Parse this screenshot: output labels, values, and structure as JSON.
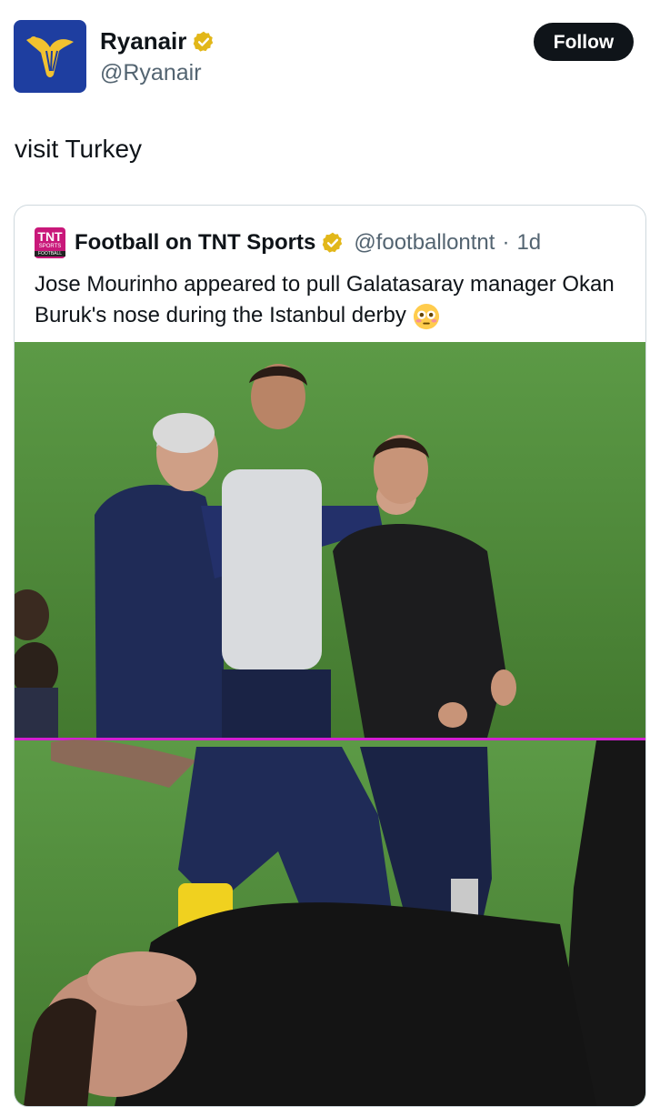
{
  "author": {
    "name": "Ryanair",
    "handle": "@Ryanair",
    "follow_label": "Follow"
  },
  "tweet": {
    "text": "visit Turkey"
  },
  "quoted_tweet": {
    "logo_text": "TNT",
    "logo_subtext": "SPORTS",
    "logo_footer": "FOOTBALL",
    "name": "Football on TNT Sports",
    "handle": "@footballontnt",
    "separator": "·",
    "time": "1d",
    "text": "Jose Mourinho appeared to pull Galatasaray manager Okan Buruk's nose during the Istanbul derby",
    "emoji": "flushed-face-emoji"
  },
  "colors": {
    "brand_blue": "#1e3ea0",
    "verified_gold": "#e2b719",
    "tnt_pink": "#c9187a",
    "pitch_green": "#4e8a3a",
    "divider_magenta": "#d21fd0"
  },
  "icons": {
    "avatar": "ryanair-harp-logo",
    "verified": "verified-badge-icon"
  }
}
